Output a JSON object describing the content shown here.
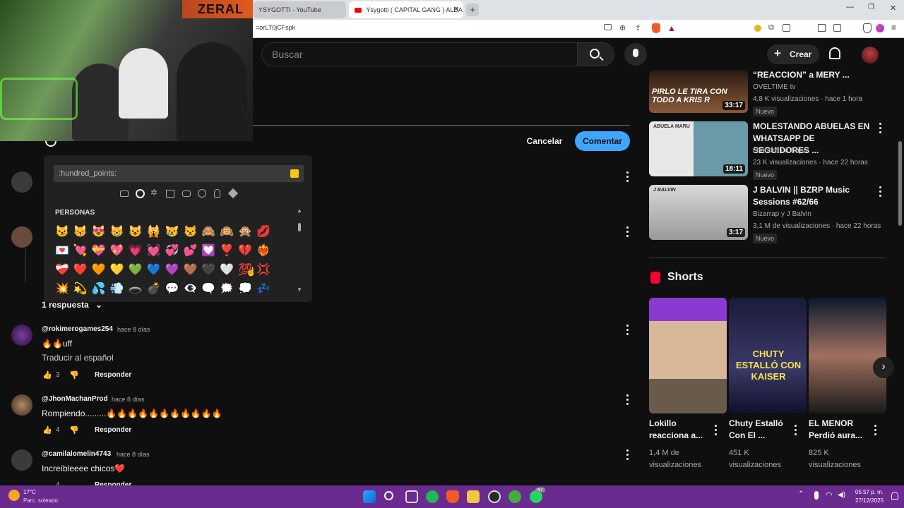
{
  "browser": {
    "tabs": [
      {
        "title": "YSYGOTTI - YouTube"
      },
      {
        "title": "Ysygotti ( CAPITAL GANG ) ALDA"
      }
    ],
    "url": "=orLT0jCFspk"
  },
  "header": {
    "search_placeholder": "Buscar",
    "create_label": "Crear"
  },
  "comment_box": {
    "cancel_label": "Cancelar",
    "submit_label": "Comentar"
  },
  "emoji_picker": {
    "search_value": ":hundred_points:",
    "category_label": "PERSONAS",
    "rows": [
      "😼😽😻😸😺🙀😿😾🙈🙉🙊💋",
      "💌💘💝💖💗💓💞💕💟❣️💔❤️‍🔥",
      "❤️‍🩹❤️🧡💛💚💙💜🤎🖤🤍💯💢",
      "💥💫💦💨🕳️💣💬👁️‍🗨️🗨️🗯️💭💤"
    ]
  },
  "comments": [
    {
      "replies_label": "1 respuesta"
    },
    {
      "user": "@rokimerogames254",
      "time": "hace 8 días",
      "text": "🔥🔥uff",
      "translate": "Traducir al español",
      "likes": "3",
      "reply": "Responder"
    },
    {
      "user": "@JhonMachanProd",
      "time": "hace 8 días",
      "text": "Rompiendo.........🔥🔥🔥🔥🔥🔥🔥🔥🔥🔥🔥",
      "likes": "4",
      "reply": "Responder"
    },
    {
      "user": "@camilalomelin4743",
      "time": "hace 8 días",
      "text": "Increíbleeee chicos❤️",
      "likes": "4",
      "reply": "Responder"
    }
  ],
  "sidebar_videos": [
    {
      "title": "“REACCION” a MERY ...",
      "channel": "OVELTIME tv",
      "meta": "4,8 K visualizaciones · hace 1 hora",
      "badge": "Nuevo",
      "duration": "33:17",
      "thumb_text": "PIRLO LE TIRA CON TODO A KRIS R"
    },
    {
      "title": "MOLESTANDO ABUELAS EN WHATSAPP DE SEGUIDORES ...",
      "channel": "Leandro La Sapa",
      "meta": "23 K visualizaciones · hace 22 horas",
      "badge": "Nuevo",
      "duration": "18:11",
      "thumb_text": "ABUELA MARU"
    },
    {
      "title": "J BALVIN || BZRP Music Sessions #62/66",
      "channel": "Bizarrap y J Balvin",
      "meta": "3,1 M de visualizaciones · hace 22 horas",
      "badge": "Nuevo",
      "duration": "3:17",
      "thumb_text": "J BALVIN"
    }
  ],
  "shorts": {
    "heading": "Shorts",
    "items": [
      {
        "title": "Lokillo reacciona a...",
        "views": "1,4 M de visualizaciones"
      },
      {
        "title": "Chuty Estalló Con El ...",
        "views": "451 K visualizaciones",
        "thumb_text": "CHUTY ESTALLÓ CON KAISER"
      },
      {
        "title": "EL MENOR Perdió aura...",
        "views": "825 K visualizaciones"
      }
    ]
  },
  "webcam": {
    "logo": "ZERAL"
  },
  "taskbar": {
    "weather_temp": "17°C",
    "weather_desc": "Parc. soleado",
    "time": "05:57 p. m.",
    "date": "27/12/2025",
    "notif_badge": "47"
  }
}
